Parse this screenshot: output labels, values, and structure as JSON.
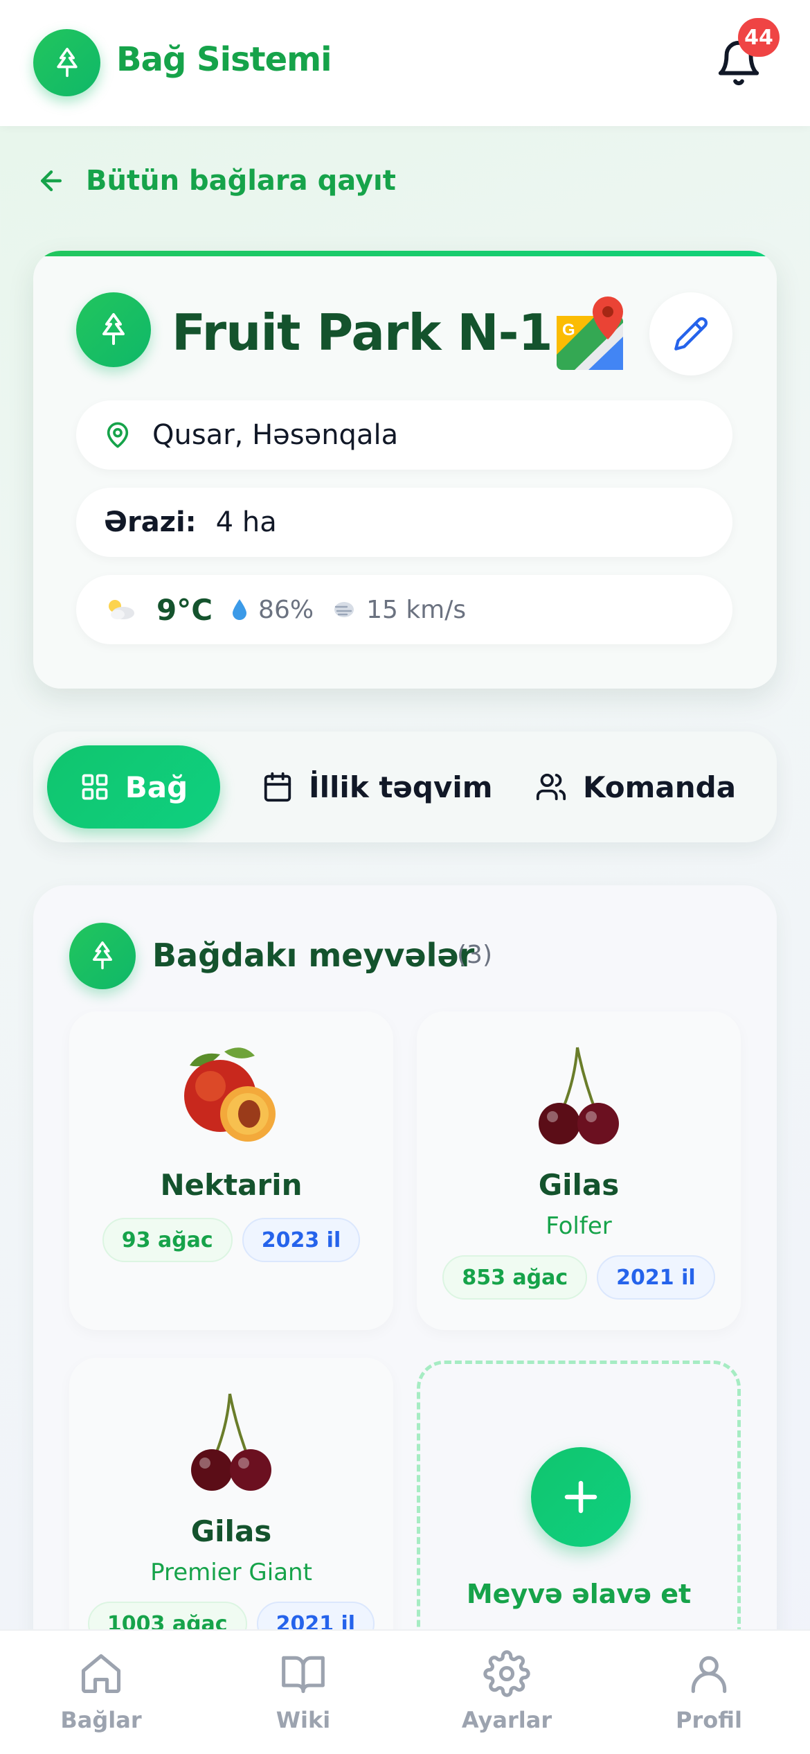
{
  "header": {
    "app_title": "Bağ Sistemi",
    "logo_icon": "tree-icon",
    "notification_count": "44",
    "bell_icon": "bell-icon"
  },
  "back_link": {
    "label": "Bütün bağlara qayıt",
    "icon": "arrow-left-icon"
  },
  "garden": {
    "name": "Fruit Park N-1",
    "location": "Qusar, Həsənqala",
    "area_label": "Ərazi:",
    "area_value": "4 ha",
    "weather": {
      "icon": "partly-cloudy-icon",
      "temperature": "9°C",
      "humidity": "86%",
      "wind": "15 km/s"
    },
    "accent_color": "#22c55e"
  },
  "tabs": [
    {
      "label": "Bağ",
      "icon": "grid-icon",
      "active": true
    },
    {
      "label": "İllik təqvim",
      "icon": "calendar-icon",
      "active": false
    },
    {
      "label": "Komanda",
      "icon": "users-icon",
      "active": false
    }
  ],
  "fruits_section": {
    "title": "Bağdakı meyvələr",
    "count": "(3)",
    "items": [
      {
        "name": "Nektarin",
        "variety": "",
        "trees": "93 ağac",
        "year": "2023 il",
        "image": "nectarine"
      },
      {
        "name": "Gilas",
        "variety": "Folfer",
        "trees": "853 ağac",
        "year": "2021 il",
        "image": "cherry"
      },
      {
        "name": "Gilas",
        "variety": "Premier Giant",
        "trees": "1003 ağac",
        "year": "2021 il",
        "image": "cherry"
      }
    ],
    "add_label": "Meyvə əlavə et"
  },
  "bottom_nav": [
    {
      "label": "Bağlar",
      "icon": "home-icon"
    },
    {
      "label": "Wiki",
      "icon": "book-icon"
    },
    {
      "label": "Ayarlar",
      "icon": "gear-icon"
    },
    {
      "label": "Profil",
      "icon": "user-icon"
    }
  ]
}
